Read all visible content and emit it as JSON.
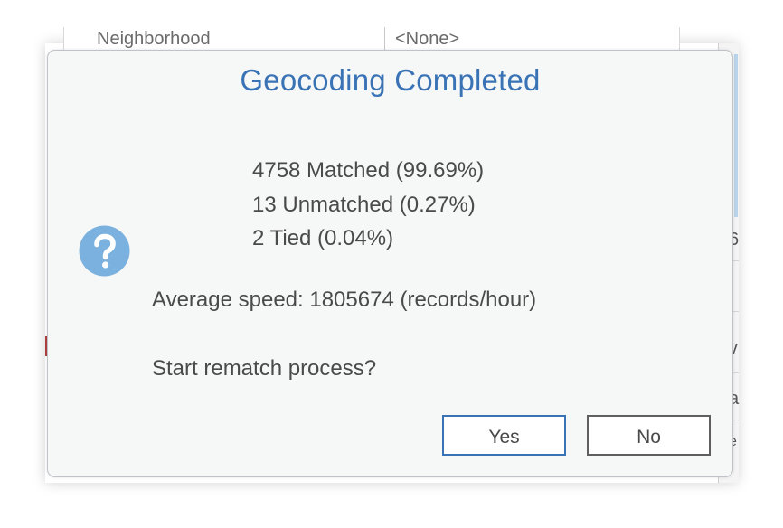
{
  "background": {
    "field_label": "Neighborhood",
    "field_value": "<None>",
    "right_column_fragments": [
      "6",
      "v",
      "a",
      "e"
    ]
  },
  "dialog": {
    "title": "Geocoding Completed",
    "stats": [
      "4758 Matched (99.69%)",
      "13 Unmatched (0.27%)",
      "2 Tied (0.04%)"
    ],
    "icon": "question-icon",
    "average_speed": "Average speed: 1805674 (records/hour)",
    "prompt": "Start rematch process?",
    "buttons": {
      "yes_label": "Yes",
      "no_label": "No"
    }
  },
  "colors": {
    "accent": "#3a73b5",
    "icon_fill": "#7ab1de",
    "text": "#4a4a4a",
    "dialog_bg": "#f6f7f7"
  }
}
